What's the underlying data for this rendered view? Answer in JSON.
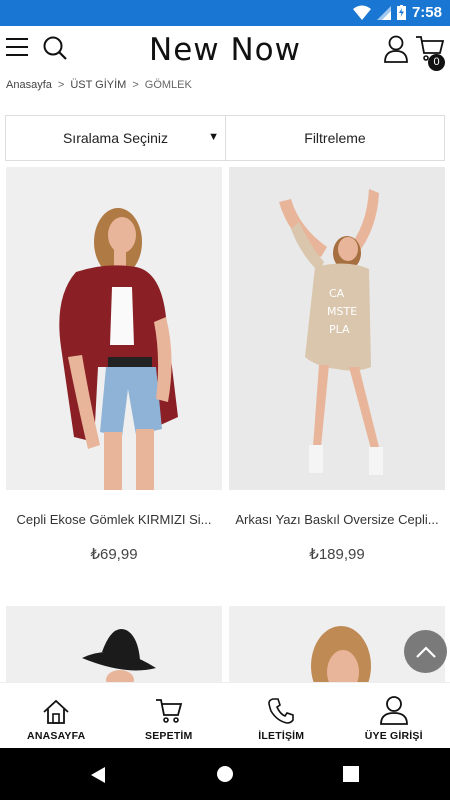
{
  "status_bar": {
    "time": "7:58",
    "icons": [
      "wifi-icon",
      "signal-icon",
      "battery-icon"
    ]
  },
  "header": {
    "logo": "New Now",
    "cart_count": "0",
    "icons": [
      "menu-icon",
      "search-icon",
      "user-icon",
      "cart-icon"
    ]
  },
  "breadcrumb": {
    "items": [
      "Anasayfa",
      "ÜST GİYİM",
      "GÖMLEK"
    ],
    "separator": ">"
  },
  "controls": {
    "sort_label": "Sıralama Seçiniz",
    "filter_label": "Filtreleme"
  },
  "products": [
    {
      "name": "Cepli Ekose Gömlek KIRMIZI Si...",
      "price": "₺69,99"
    },
    {
      "name": "Arkası Yazı Baskıl Oversize Cepli...",
      "price": "₺189,99"
    }
  ],
  "bottom_nav": [
    {
      "label": "ANASAYFA",
      "icon": "home-icon"
    },
    {
      "label": "SEPETİM",
      "icon": "cart-icon"
    },
    {
      "label": "İLETİŞİM",
      "icon": "phone-icon"
    },
    {
      "label": "ÜYE GİRİŞİ",
      "icon": "user-icon"
    }
  ],
  "colors": {
    "status_bar": "#1976d2",
    "accent": "#111111",
    "scroll_button": "#7a7a7a"
  }
}
